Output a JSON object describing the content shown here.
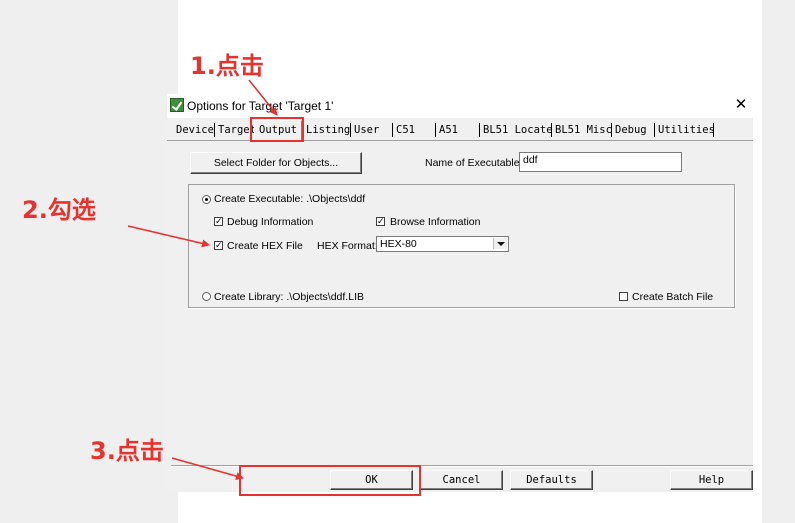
{
  "dialog": {
    "title": "Options for Target 'Target 1'",
    "close_glyph": "✕",
    "tabs": [
      "Device",
      "Target",
      "Output",
      "Listing",
      "User",
      "C51",
      "A51",
      "BL51 Locate",
      "BL51 Misc",
      "Debug",
      "Utilities"
    ],
    "active_tab": "Output"
  },
  "output": {
    "select_folder_label": "Select Folder for Objects...",
    "name_of_executable_label": "Name of Executable:",
    "name_of_executable_value": "ddf",
    "create_executable_label": "Create Executable:  .\\Objects\\ddf",
    "create_executable_selected": true,
    "debug_info_label": "Debug Information",
    "debug_info_checked": true,
    "browse_info_label": "Browse Information",
    "browse_info_checked": true,
    "create_hex_label": "Create HEX File",
    "create_hex_checked": true,
    "hex_format_label": "HEX Format:",
    "hex_format_value": "HEX-80",
    "create_library_label": "Create Library:  .\\Objects\\ddf.LIB",
    "create_library_selected": false,
    "create_batch_label": "Create Batch File",
    "create_batch_checked": false
  },
  "footer": {
    "ok": "OK",
    "cancel": "Cancel",
    "defaults": "Defaults",
    "help": "Help"
  },
  "annotations": {
    "step1": "1.点击",
    "step2": "2.勾选",
    "step3": "3.点击",
    "color": "#e8322d"
  },
  "icons": {
    "app": "keil-uvision-icon",
    "close": "close-icon",
    "dropdown": "chevron-down-icon"
  }
}
